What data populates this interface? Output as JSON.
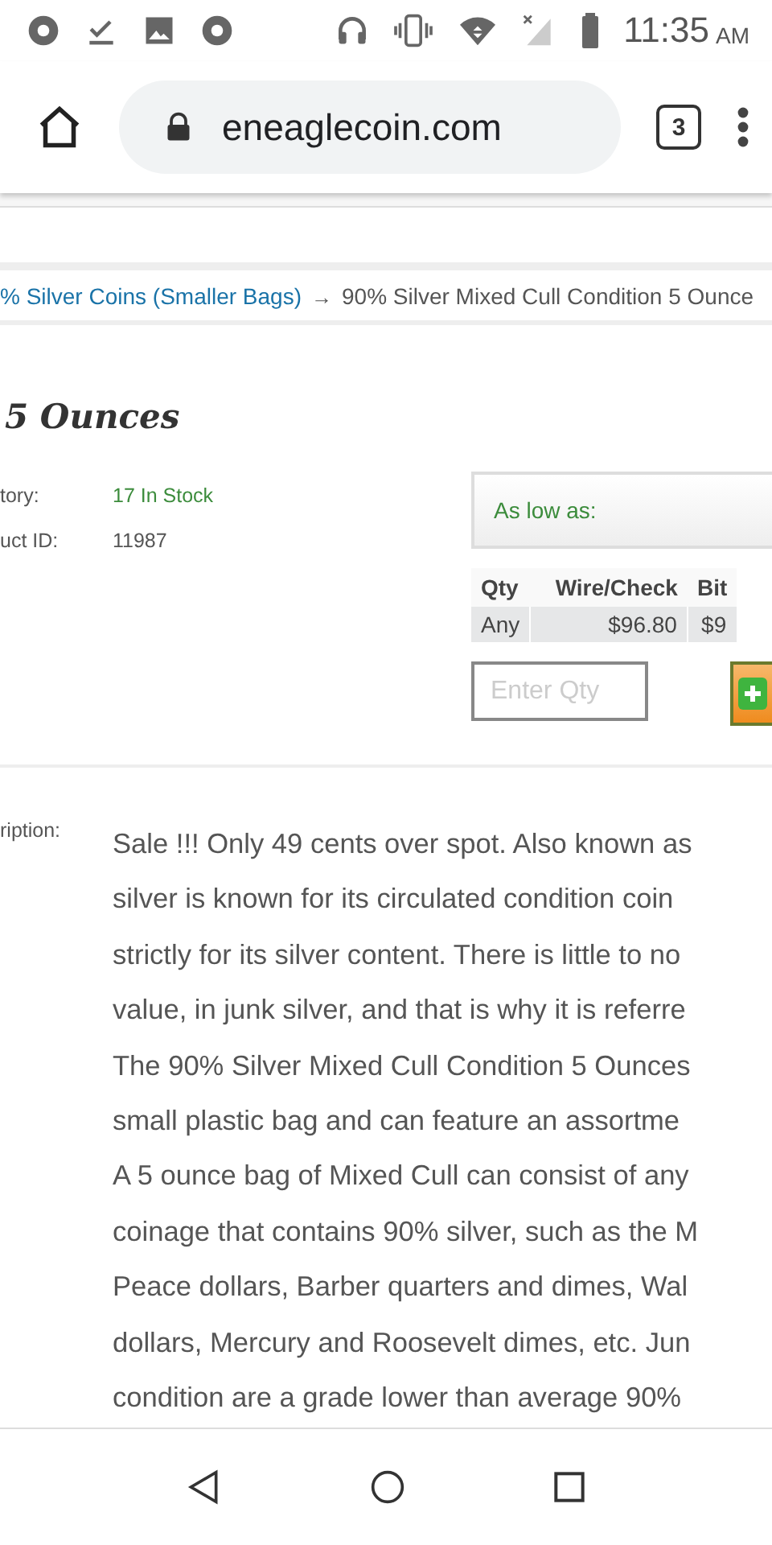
{
  "status_bar": {
    "time": "11:35",
    "ampm": "AM"
  },
  "browser": {
    "url": "eneaglecoin.com",
    "tab_count": "3"
  },
  "breadcrumb": {
    "link": "% Silver Coins (Smaller Bags)",
    "separator": "→",
    "current": "90% Silver Mixed Cull Condition 5 Ounce"
  },
  "product": {
    "title": "5 Ounces",
    "info": [
      {
        "label": "tory:",
        "value": "17 In Stock",
        "kind": "stock"
      },
      {
        "label": "uct ID:",
        "value": "11987",
        "kind": "plain"
      }
    ],
    "price_box": {
      "label": "As low as:"
    },
    "price_table": {
      "columns": [
        "Qty",
        "Wire/Check",
        "Bit"
      ],
      "rows": [
        [
          "Any",
          "$96.80",
          "$9"
        ]
      ]
    },
    "qty_field": {
      "placeholder": "Enter Qty"
    },
    "description": {
      "label": "ription:",
      "lines": [
        "Sale !!! Only 49 cents over spot. Also known as",
        "silver is known for its circulated condition coin",
        "strictly for its silver content. There is little to no",
        "value, in junk silver, and that is why it is referre",
        "The 90% Silver Mixed Cull Condition 5 Ounces",
        "small plastic bag and can feature an assortme",
        "A 5 ounce bag of Mixed Cull can consist of any",
        "coinage that contains 90% silver, such as the M",
        "Peace dollars, Barber quarters and dimes, Wal",
        "dollars, Mercury and Roosevelt dimes, etc. Jun",
        "condition are a grade lower than average 90%"
      ]
    }
  }
}
